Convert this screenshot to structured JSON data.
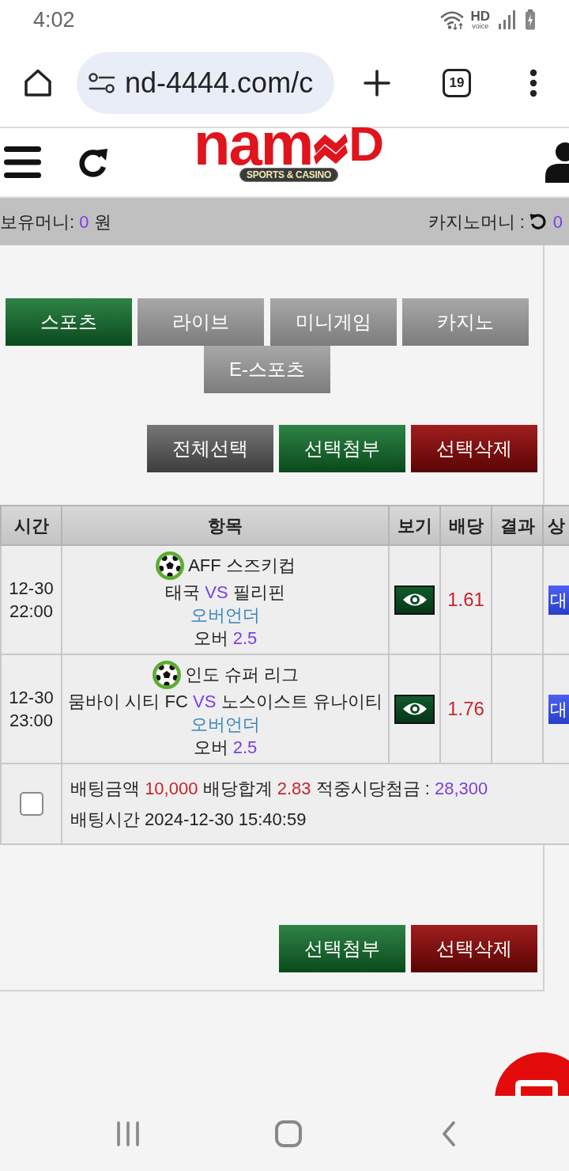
{
  "status_bar": {
    "time": "4:02",
    "hd_label": "HD",
    "voice_label": "voice"
  },
  "browser_bar": {
    "url": "nd-4444.com/c",
    "tab_count": "19"
  },
  "header": {
    "logo_start": "nam",
    "logo_end": "D",
    "tagline": "SPORTS & CASINO"
  },
  "money_bar": {
    "holding_label": "보유머니:",
    "holding_value": "0",
    "holding_unit": "원",
    "casino_label": "카지노머니 :",
    "casino_value": "0"
  },
  "tabs": [
    {
      "label": "스포츠",
      "selected": true
    },
    {
      "label": "라이브",
      "selected": false
    },
    {
      "label": "미니게임",
      "selected": false
    },
    {
      "label": "카지노",
      "selected": false
    },
    {
      "label": "E-스포츠",
      "selected": false
    }
  ],
  "top_actions": [
    {
      "label": "전체선택",
      "kind": "neutral"
    },
    {
      "label": "선택첨부",
      "kind": "confirm"
    },
    {
      "label": "선택삭제",
      "kind": "danger"
    }
  ],
  "table": {
    "columns": [
      "시간",
      "항목",
      "보기",
      "배당",
      "결과",
      "상"
    ],
    "rows": [
      {
        "date": "12-30",
        "time": "22:00",
        "league": "AFF 스즈키컵",
        "home": "태국",
        "vs": "VS",
        "away": "필리핀",
        "market": "오버언더",
        "pick": "오버",
        "line": "2.5",
        "odds": "1.61",
        "status": "대"
      },
      {
        "date": "12-30",
        "time": "23:00",
        "league": "인도 슈퍼 리그",
        "home": "뭄바이 시티 FC",
        "vs": "VS",
        "away": "노스이스트 유나이티",
        "market": "오버언더",
        "pick": "오버",
        "line": "2.5",
        "odds": "1.76",
        "status": "대"
      }
    ],
    "summary": {
      "checked": false,
      "stake_label": "배팅금액",
      "stake": "10,000",
      "odds_label": "배당합계",
      "odds": "2.83",
      "payout_label": "적중시당첨금 :",
      "payout": "28,300",
      "time_label": "배팅시간",
      "time": "2024-12-30 15:40:59"
    }
  },
  "bottom_actions": [
    {
      "label": "선택첨부",
      "kind": "confirm"
    },
    {
      "label": "선택삭제",
      "kind": "danger"
    }
  ]
}
